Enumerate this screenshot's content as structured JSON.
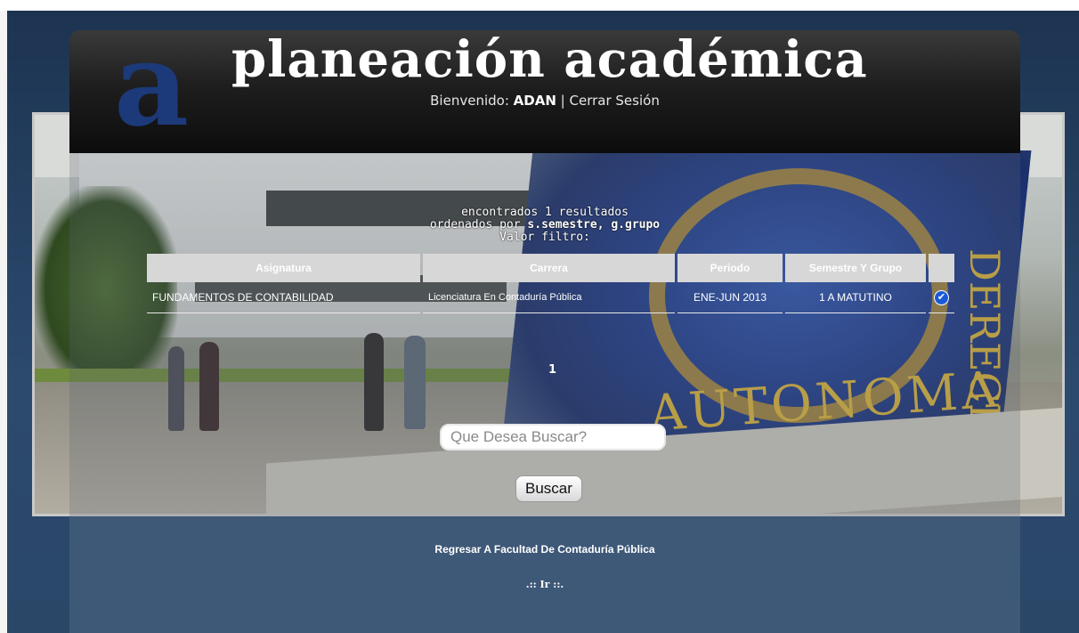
{
  "header": {
    "logo_letter": "a",
    "title": "planeación académica",
    "welcome_prefix": "Bienvenido:",
    "user": "ADAN",
    "separator": "|",
    "logout": "Cerrar Sesión"
  },
  "results_meta": {
    "found": "encontrados 1 resultados",
    "ordered_prefix": "ordenados por",
    "ordered_by": "s.semestre, g.grupo",
    "filter_label": "Valor filtro:"
  },
  "table": {
    "columns": [
      "Asignatura",
      "Carrera",
      "Periodo",
      "Semestre Y Grupo",
      ""
    ],
    "rows": [
      {
        "asignatura": "FUNDAMENTOS DE CONTABILIDAD",
        "carrera": "Licenciatura En Contaduría Pública",
        "periodo": "ENE-JUN 2013",
        "semestre_grupo": "1 A MATUTINO",
        "check_icon": "check-circle-icon"
      }
    ]
  },
  "pagination": {
    "current": "1"
  },
  "search": {
    "placeholder": "Que Desea Buscar?",
    "button": "Buscar"
  },
  "footer": {
    "back_link": "Regresar A Facultad De Contaduría Pública",
    "go_link": ".:: Ir ::."
  },
  "photo": {
    "mural_word": "AUTONOMA",
    "mural_side": "DERECHO"
  },
  "colors": {
    "header_bg": "#111111",
    "logo": "#1c3a7a",
    "page_bg": "#2c4a6e",
    "check": "#1a5ad8"
  }
}
